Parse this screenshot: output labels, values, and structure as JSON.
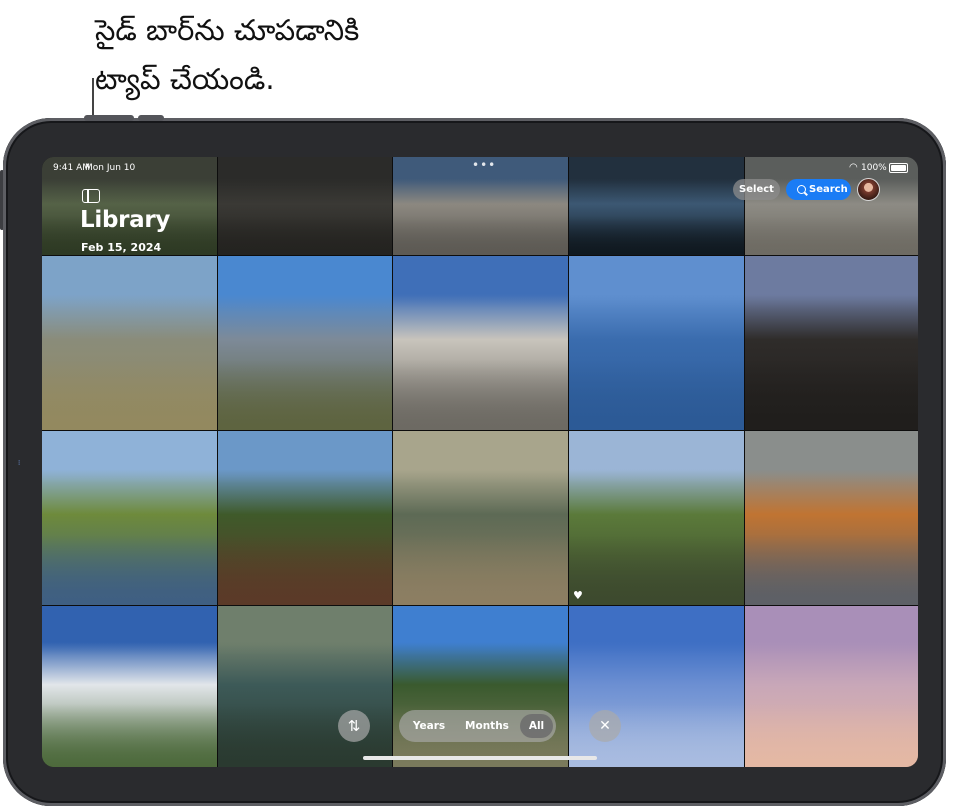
{
  "callout": {
    "line1": "సైడ్ బార్‌ను చూపడానికి",
    "line2": "ట్యాప్ చేయండి."
  },
  "statusbar": {
    "time": "9:41 AM",
    "date": "Mon Jun 10",
    "battery": "100%"
  },
  "library": {
    "title": "Library",
    "date": "Feb 15, 2024"
  },
  "toolbar": {
    "select_label": "Select",
    "search_label": "Search"
  },
  "view_switcher": {
    "years_label": "Years",
    "months_label": "Months",
    "all_label": "All",
    "selected": "All"
  },
  "icons": {
    "sidebar": "sidebar-icon",
    "search": "search-icon",
    "sort": "sort-icon",
    "close": "close-icon",
    "favorite": "heart-icon",
    "wifi": "wifi-icon",
    "battery": "battery-icon",
    "more": "more-icon"
  },
  "photos": [
    {
      "subject": "lake-dark",
      "colors": [
        "#3b3f36",
        "#556247",
        "#2e3a24"
      ]
    },
    {
      "subject": "rock-dark",
      "colors": [
        "#2b2b29",
        "#3a3935",
        "#242320"
      ]
    },
    {
      "subject": "rock-columns",
      "colors": [
        "#3f5a7a",
        "#8c8880",
        "#5d5a54"
      ]
    },
    {
      "subject": "pond-rock",
      "colors": [
        "#22303e",
        "#3c5873",
        "#101920"
      ]
    },
    {
      "subject": "rocky-shore",
      "colors": [
        "#5b5e5c",
        "#8d8b84",
        "#6e6b63"
      ]
    },
    {
      "subject": "lake-sand",
      "colors": [
        "#7da3c8",
        "#8a8c7a",
        "#93895f"
      ]
    },
    {
      "subject": "canyon-creek",
      "colors": [
        "#4a88d0",
        "#7d8a98",
        "#5e6440"
      ]
    },
    {
      "subject": "tufa-columns",
      "colors": [
        "#3f6fb8",
        "#c8c4bc",
        "#6d6a63"
      ]
    },
    {
      "subject": "water-reflection",
      "colors": [
        "#5f8fcf",
        "#3a6cae",
        "#2c5a96"
      ]
    },
    {
      "subject": "volcanic-rock",
      "colors": [
        "#6d7ba0",
        "#2f2c2a",
        "#201e1c"
      ]
    },
    {
      "subject": "meadow-stream",
      "colors": [
        "#8fb2d8",
        "#6e8a3b",
        "#3f5f82"
      ]
    },
    {
      "subject": "juniper-tree",
      "colors": [
        "#6b98c8",
        "#3f5a2a",
        "#5b3a28"
      ]
    },
    {
      "subject": "hot-spring",
      "colors": [
        "#a8a58c",
        "#5d6a55",
        "#8c7e62"
      ]
    },
    {
      "subject": "river-wildflowers",
      "colors": [
        "#9bb5d6",
        "#5b7a3a",
        "#3d4a2e"
      ]
    },
    {
      "subject": "orange-lichen",
      "colors": [
        "#8a8e8c",
        "#c07432",
        "#5d6066"
      ]
    },
    {
      "subject": "clouds-sky",
      "colors": [
        "#3162b0",
        "#e2e6ea",
        "#4d6a3c"
      ]
    },
    {
      "subject": "clear-creek",
      "colors": [
        "#6f7f6c",
        "#3d5a58",
        "#2a3a30"
      ]
    },
    {
      "subject": "pine-forest",
      "colors": [
        "#3f7fd0",
        "#3a5a2e",
        "#7a7a5c"
      ]
    },
    {
      "subject": "pink-flower",
      "colors": [
        "#3e6fc4",
        "#6c8fd2",
        "#a9bce0"
      ]
    },
    {
      "subject": "purple-flower",
      "colors": [
        "#a98fb8",
        "#c8a7b8",
        "#e4b8a4"
      ]
    }
  ]
}
